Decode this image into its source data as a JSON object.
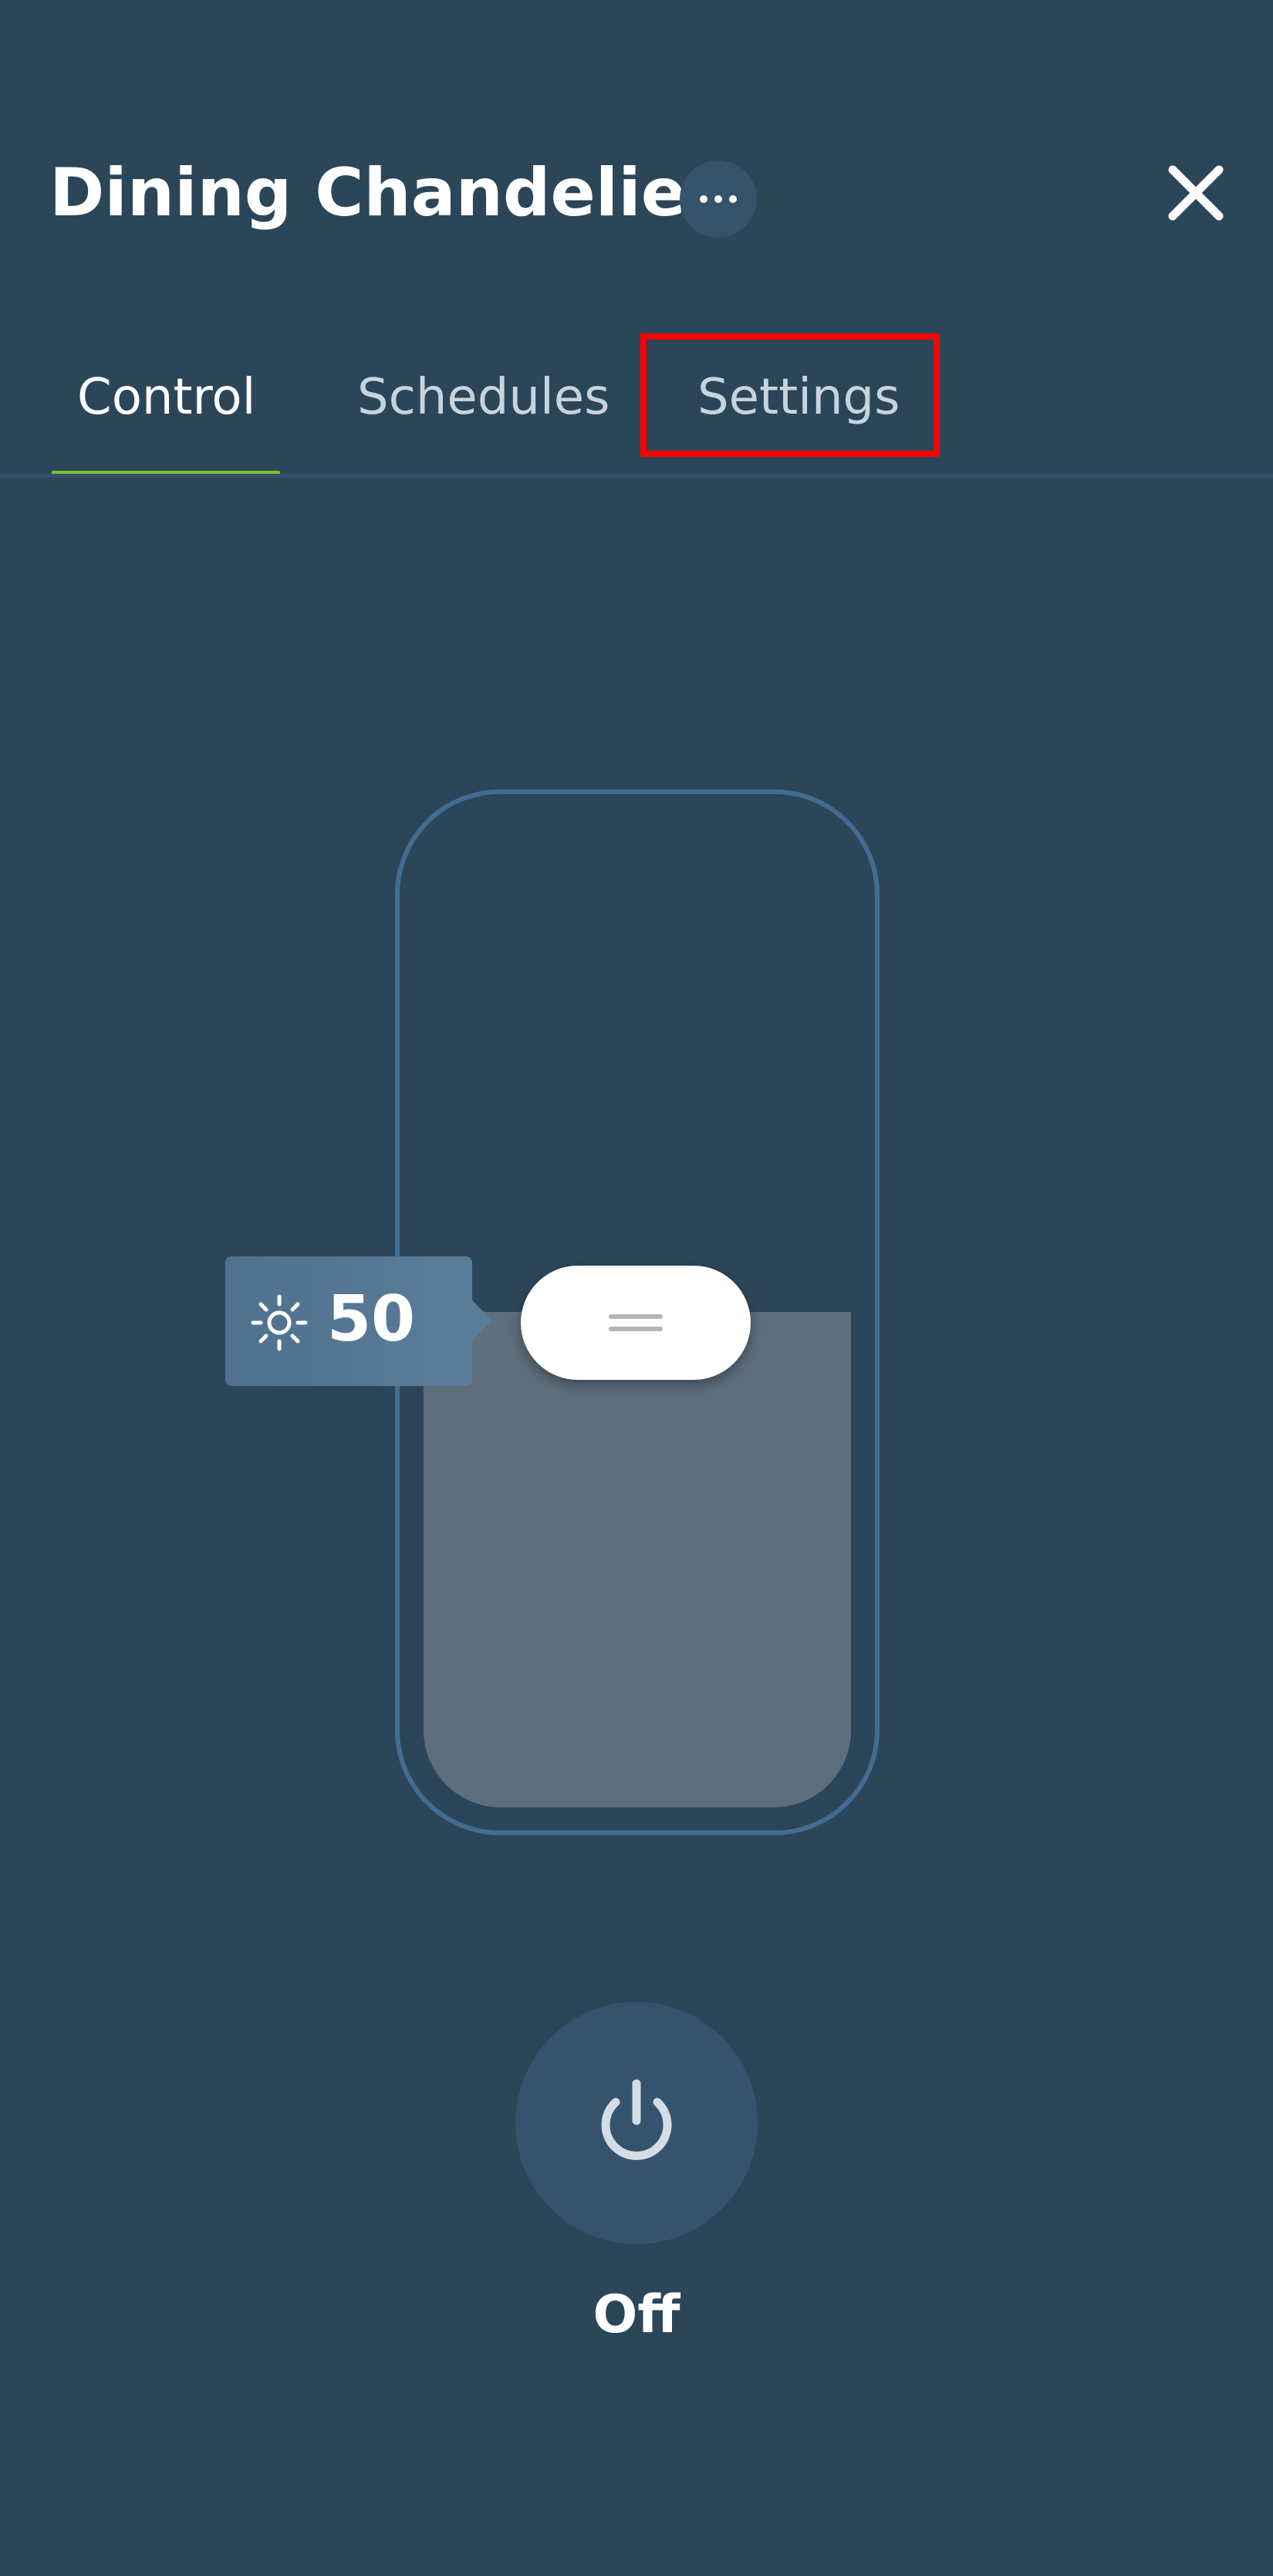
{
  "header": {
    "title": "Dining Chandelier",
    "more_icon": "more-horizontal-icon",
    "close_icon": "close-icon"
  },
  "tabs": [
    {
      "label": "Control",
      "active": true
    },
    {
      "label": "Schedules",
      "active": false
    },
    {
      "label": "Settings",
      "active": false,
      "highlighted": true
    }
  ],
  "brightness": {
    "icon": "sun-icon",
    "value": "50",
    "level_percent": 50
  },
  "power": {
    "icon": "power-icon",
    "label": "Off"
  },
  "colors": {
    "background": "#2c4659",
    "active_tab_underline": "#7cc32b",
    "highlight_box": "#ff0000",
    "slider_border": "#426d93",
    "slider_fill": "#5d6e7c"
  }
}
